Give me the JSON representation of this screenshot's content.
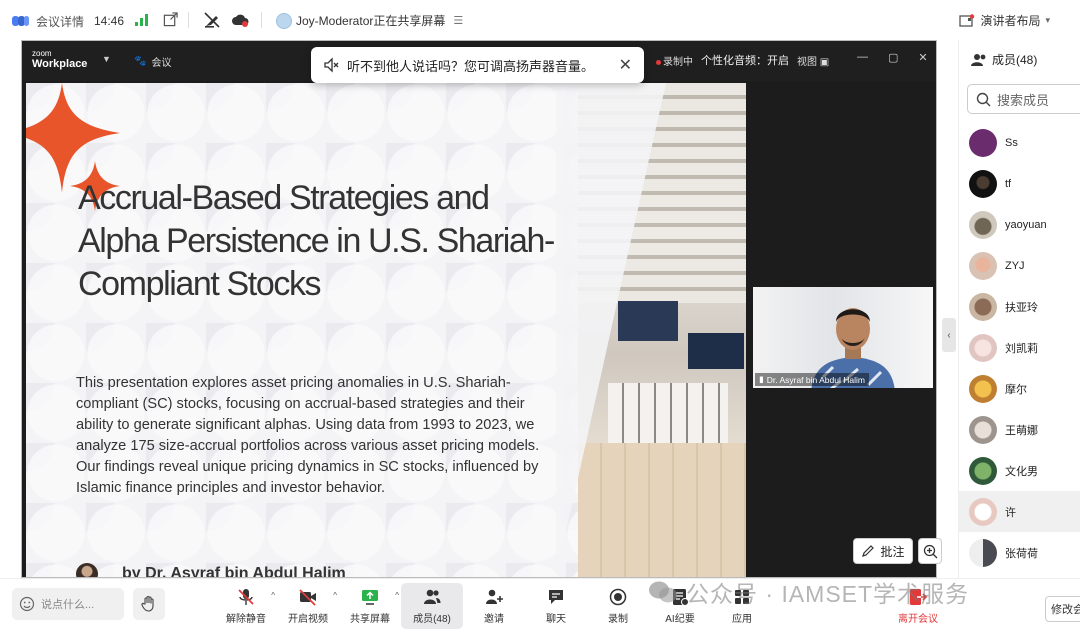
{
  "topbar": {
    "meeting_details": "会议详情",
    "time": "14:46",
    "presenter_status": "Joy-Moderator正在共享屏幕",
    "layout_label": "演讲者布局"
  },
  "zoom": {
    "brand_small": "zoom",
    "brand_big": "Workplace",
    "meeting_label": "会议",
    "recording": "录制中",
    "personalize": "个性化音频：开启",
    "view": "视图"
  },
  "toast": {
    "message": "听不到他人说话吗？您可调高扬声器音量。"
  },
  "slide": {
    "title": "Accrual-Based Strategies and Alpha Persistence in U.S. Shariah-Compliant Stocks",
    "body": "This presentation explores asset pricing anomalies in U.S. Shariah-compliant (SC) stocks, focusing on accrual-based strategies and their ability to generate significant alphas. Using data from 1993 to 2023, we analyze 175 size-accrual portfolios across various asset pricing models. Our findings reveal unique pricing dynamics in SC stocks, influenced by Islamic finance principles and investor behavior.",
    "author": "by Dr. Asyraf bin Abdul Halim"
  },
  "video": {
    "speaker_name": "Dr. Asyraf bin Abdul Halim"
  },
  "annotate_label": "批注",
  "panel": {
    "title": "成员(48)",
    "search_placeholder": "搜索成员",
    "members": [
      {
        "name": "Ss",
        "color": "#6b2c6e"
      },
      {
        "name": "tf",
        "color": "#1a1a1a"
      },
      {
        "name": "yaoyuan",
        "color": "#8a7f6a"
      },
      {
        "name": "ZYJ",
        "color": "#c9a08a"
      },
      {
        "name": "扶亚玲",
        "color": "#9c7b66"
      },
      {
        "name": "刘凯莉",
        "color": "#e8d3d0"
      },
      {
        "name": "摩尔",
        "color": "#d8a24a"
      },
      {
        "name": "王萌娜",
        "color": "#b9b2ac"
      },
      {
        "name": "文化男",
        "color": "#3f7c4a"
      },
      {
        "name": "许",
        "color": "#f3e9e6"
      },
      {
        "name": "张荷荷",
        "color": "#7a7b80"
      }
    ]
  },
  "bottom": {
    "chat_placeholder": "说点什么...",
    "tools": [
      {
        "label": "解除静音",
        "icon": "mic-off-icon"
      },
      {
        "label": "开启视频",
        "icon": "video-off-icon"
      },
      {
        "label": "共享屏幕",
        "icon": "share-screen-icon"
      },
      {
        "label": "成员(48)",
        "icon": "members-icon"
      },
      {
        "label": "邀请",
        "icon": "invite-icon"
      },
      {
        "label": "聊天",
        "icon": "chat-icon"
      },
      {
        "label": "录制",
        "icon": "record-icon"
      },
      {
        "label": "AI纪要",
        "icon": "ai-notes-icon"
      },
      {
        "label": "应用",
        "icon": "apps-icon"
      }
    ],
    "leave": "离开会议",
    "modify": "修改会"
  },
  "watermark": "公众号 · IAMSET学术服务"
}
